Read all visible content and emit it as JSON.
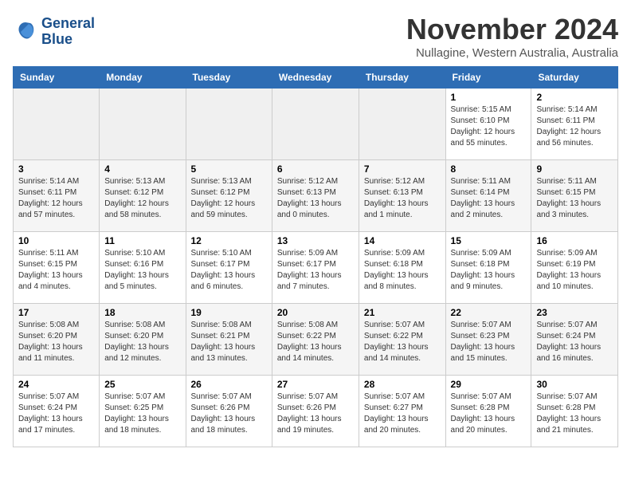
{
  "logo": {
    "line1": "General",
    "line2": "Blue"
  },
  "title": "November 2024",
  "subtitle": "Nullagine, Western Australia, Australia",
  "weekdays": [
    "Sunday",
    "Monday",
    "Tuesday",
    "Wednesday",
    "Thursday",
    "Friday",
    "Saturday"
  ],
  "weeks": [
    [
      {
        "day": "",
        "info": ""
      },
      {
        "day": "",
        "info": ""
      },
      {
        "day": "",
        "info": ""
      },
      {
        "day": "",
        "info": ""
      },
      {
        "day": "",
        "info": ""
      },
      {
        "day": "1",
        "info": "Sunrise: 5:15 AM\nSunset: 6:10 PM\nDaylight: 12 hours\nand 55 minutes."
      },
      {
        "day": "2",
        "info": "Sunrise: 5:14 AM\nSunset: 6:11 PM\nDaylight: 12 hours\nand 56 minutes."
      }
    ],
    [
      {
        "day": "3",
        "info": "Sunrise: 5:14 AM\nSunset: 6:11 PM\nDaylight: 12 hours\nand 57 minutes."
      },
      {
        "day": "4",
        "info": "Sunrise: 5:13 AM\nSunset: 6:12 PM\nDaylight: 12 hours\nand 58 minutes."
      },
      {
        "day": "5",
        "info": "Sunrise: 5:13 AM\nSunset: 6:12 PM\nDaylight: 12 hours\nand 59 minutes."
      },
      {
        "day": "6",
        "info": "Sunrise: 5:12 AM\nSunset: 6:13 PM\nDaylight: 13 hours\nand 0 minutes."
      },
      {
        "day": "7",
        "info": "Sunrise: 5:12 AM\nSunset: 6:13 PM\nDaylight: 13 hours\nand 1 minute."
      },
      {
        "day": "8",
        "info": "Sunrise: 5:11 AM\nSunset: 6:14 PM\nDaylight: 13 hours\nand 2 minutes."
      },
      {
        "day": "9",
        "info": "Sunrise: 5:11 AM\nSunset: 6:15 PM\nDaylight: 13 hours\nand 3 minutes."
      }
    ],
    [
      {
        "day": "10",
        "info": "Sunrise: 5:11 AM\nSunset: 6:15 PM\nDaylight: 13 hours\nand 4 minutes."
      },
      {
        "day": "11",
        "info": "Sunrise: 5:10 AM\nSunset: 6:16 PM\nDaylight: 13 hours\nand 5 minutes."
      },
      {
        "day": "12",
        "info": "Sunrise: 5:10 AM\nSunset: 6:17 PM\nDaylight: 13 hours\nand 6 minutes."
      },
      {
        "day": "13",
        "info": "Sunrise: 5:09 AM\nSunset: 6:17 PM\nDaylight: 13 hours\nand 7 minutes."
      },
      {
        "day": "14",
        "info": "Sunrise: 5:09 AM\nSunset: 6:18 PM\nDaylight: 13 hours\nand 8 minutes."
      },
      {
        "day": "15",
        "info": "Sunrise: 5:09 AM\nSunset: 6:18 PM\nDaylight: 13 hours\nand 9 minutes."
      },
      {
        "day": "16",
        "info": "Sunrise: 5:09 AM\nSunset: 6:19 PM\nDaylight: 13 hours\nand 10 minutes."
      }
    ],
    [
      {
        "day": "17",
        "info": "Sunrise: 5:08 AM\nSunset: 6:20 PM\nDaylight: 13 hours\nand 11 minutes."
      },
      {
        "day": "18",
        "info": "Sunrise: 5:08 AM\nSunset: 6:20 PM\nDaylight: 13 hours\nand 12 minutes."
      },
      {
        "day": "19",
        "info": "Sunrise: 5:08 AM\nSunset: 6:21 PM\nDaylight: 13 hours\nand 13 minutes."
      },
      {
        "day": "20",
        "info": "Sunrise: 5:08 AM\nSunset: 6:22 PM\nDaylight: 13 hours\nand 14 minutes."
      },
      {
        "day": "21",
        "info": "Sunrise: 5:07 AM\nSunset: 6:22 PM\nDaylight: 13 hours\nand 14 minutes."
      },
      {
        "day": "22",
        "info": "Sunrise: 5:07 AM\nSunset: 6:23 PM\nDaylight: 13 hours\nand 15 minutes."
      },
      {
        "day": "23",
        "info": "Sunrise: 5:07 AM\nSunset: 6:24 PM\nDaylight: 13 hours\nand 16 minutes."
      }
    ],
    [
      {
        "day": "24",
        "info": "Sunrise: 5:07 AM\nSunset: 6:24 PM\nDaylight: 13 hours\nand 17 minutes."
      },
      {
        "day": "25",
        "info": "Sunrise: 5:07 AM\nSunset: 6:25 PM\nDaylight: 13 hours\nand 18 minutes."
      },
      {
        "day": "26",
        "info": "Sunrise: 5:07 AM\nSunset: 6:26 PM\nDaylight: 13 hours\nand 18 minutes."
      },
      {
        "day": "27",
        "info": "Sunrise: 5:07 AM\nSunset: 6:26 PM\nDaylight: 13 hours\nand 19 minutes."
      },
      {
        "day": "28",
        "info": "Sunrise: 5:07 AM\nSunset: 6:27 PM\nDaylight: 13 hours\nand 20 minutes."
      },
      {
        "day": "29",
        "info": "Sunrise: 5:07 AM\nSunset: 6:28 PM\nDaylight: 13 hours\nand 20 minutes."
      },
      {
        "day": "30",
        "info": "Sunrise: 5:07 AM\nSunset: 6:28 PM\nDaylight: 13 hours\nand 21 minutes."
      }
    ]
  ]
}
